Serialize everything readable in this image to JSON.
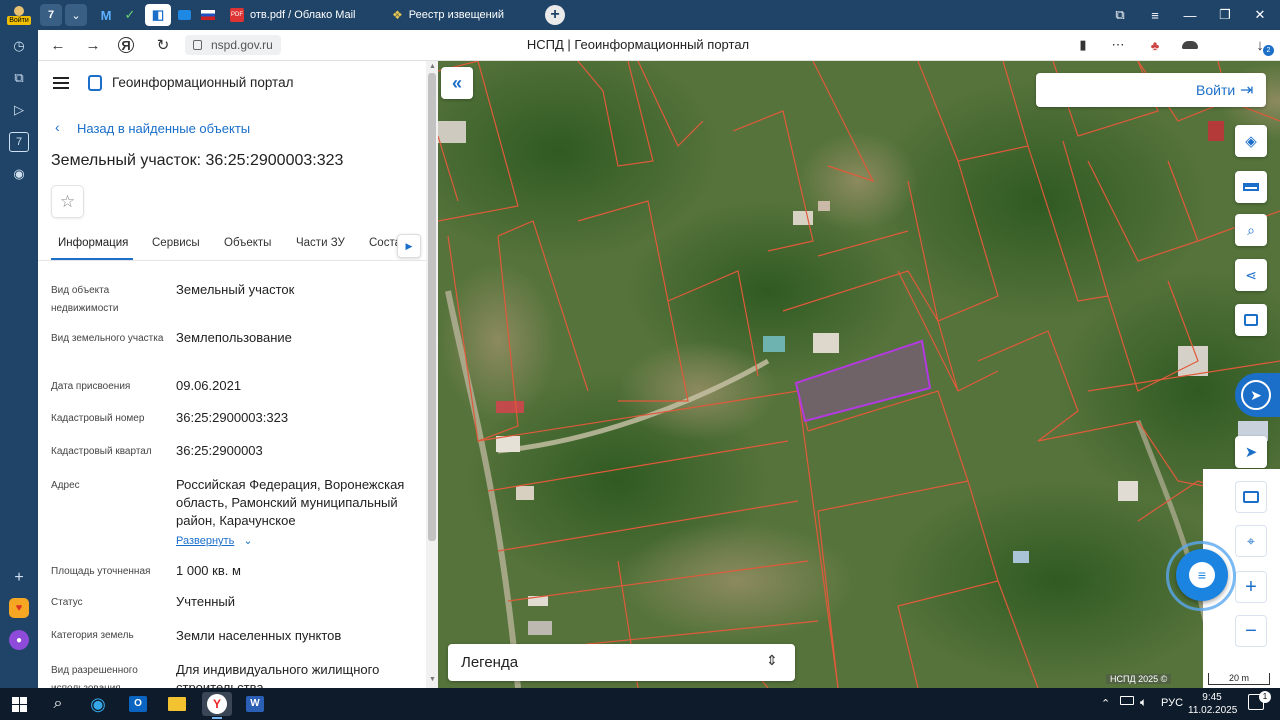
{
  "browser": {
    "login_badge": "Войти",
    "tab_count": "7",
    "tabs": [
      {
        "label": "отв.pdf / Облако Mail"
      },
      {
        "label": "Реестр извещений"
      }
    ],
    "page_title": "НСПД | Геоинформационный портал",
    "url": "nspd.gov.ru",
    "downloads_count": "2"
  },
  "panel": {
    "portal_name": "Геоинформационный портал",
    "back_link": "Назад в найденные объекты",
    "title": "Земельный участок: 36:25:2900003:323",
    "tabs": [
      "Информация",
      "Сервисы",
      "Объекты",
      "Части ЗУ",
      "Соста"
    ],
    "fields": [
      {
        "label": "Вид объекта недвижимости",
        "value": "Земельный участок"
      },
      {
        "label": "Вид земельного участка",
        "value": "Землепользование"
      },
      {
        "label": "Дата присвоения",
        "value": "09.06.2021"
      },
      {
        "label": "Кадастровый номер",
        "value": "36:25:2900003:323"
      },
      {
        "label": "Кадастровый квартал",
        "value": "36:25:2900003"
      },
      {
        "label": "Адрес",
        "value": "Российская Федерация, Воронежская область, Рамонский муниципальный район, Карачунское"
      },
      {
        "label": "Площадь уточненная",
        "value": "1 000 кв. м"
      },
      {
        "label": "Статус",
        "value": "Учтенный"
      },
      {
        "label": "Категория земель",
        "value": "Земли населенных пунктов"
      },
      {
        "label": "Вид разрешенного использования",
        "value": "Для индивидуального жилищного строительства"
      }
    ],
    "expand_link": "Развернуть"
  },
  "map": {
    "login_button": "Войти",
    "legend_label": "Легенда",
    "copyright": "НСПД 2025 ©",
    "scale_label": "20 m",
    "colors": {
      "parcel_border": "#e05a3a",
      "selected_parcel": "#b23adf",
      "accent": "#1b6fc9"
    }
  },
  "taskbar": {
    "language": "РУС",
    "time": "9:45",
    "date": "11.02.2025",
    "notifications": "1"
  }
}
